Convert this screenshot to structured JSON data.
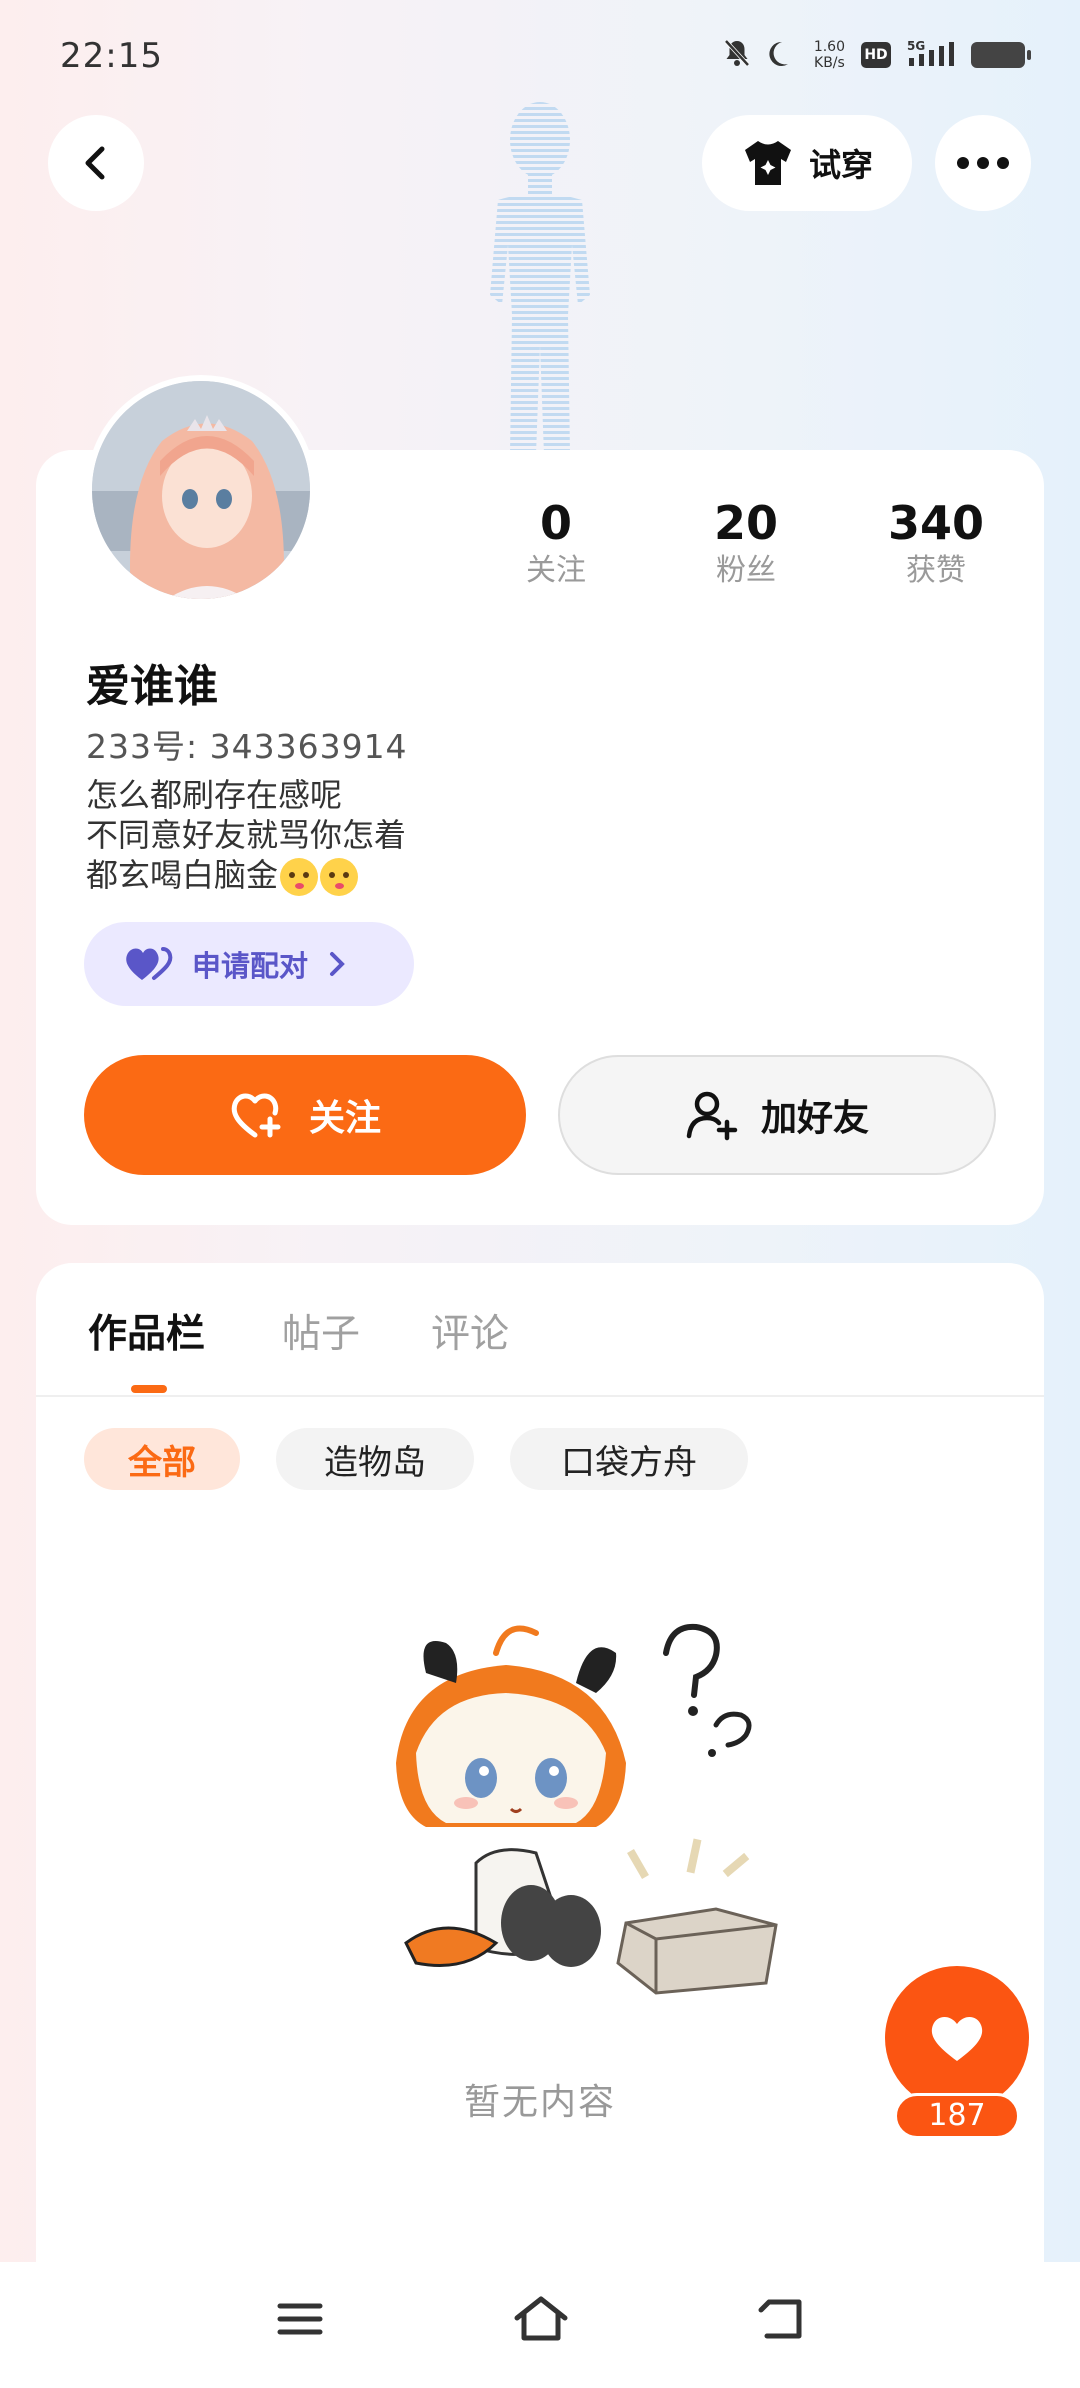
{
  "status_bar": {
    "time": "22:15",
    "net_speed_value": "1.60",
    "net_speed_unit": "KB/s",
    "hd_label": "HD",
    "network_label": "5G"
  },
  "header": {
    "tryon_label": "试穿"
  },
  "profile": {
    "stats": [
      {
        "value": "0",
        "label": "关注"
      },
      {
        "value": "20",
        "label": "粉丝"
      },
      {
        "value": "340",
        "label": "获赞"
      }
    ],
    "username": "爱谁谁",
    "uid": "233号: 343363914",
    "bio_lines": [
      "怎么都刷存在感呢",
      "不同意好友就骂你怎着",
      "都玄喝白脑金"
    ],
    "pair_label": "申请配对",
    "follow_label": "关注",
    "add_friend_label": "加好友"
  },
  "content": {
    "tabs": [
      "作品栏",
      "帖子",
      "评论"
    ],
    "active_tab": 0,
    "chips": [
      "全部",
      "造物岛",
      "口袋方舟"
    ],
    "active_chip": 0,
    "empty_text": "暂无内容"
  },
  "like": {
    "count": "187"
  },
  "colors": {
    "accent": "#fb6a14",
    "pair_bg": "#ebe9ff",
    "pair_text": "#5a56c8"
  }
}
